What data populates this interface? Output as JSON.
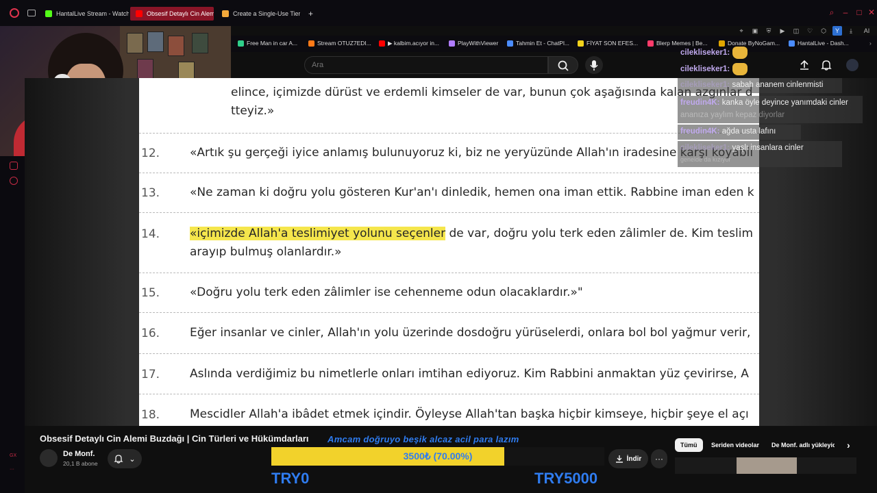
{
  "browser": {
    "tabs": [
      {
        "label": "HantalLive Stream - Watch",
        "color": "#53fc18",
        "active": false
      },
      {
        "label": "Obsesif Detaylı Cin Alemi",
        "color": "#ff0000",
        "active": true
      },
      {
        "label": "Create a Single-Use Tier L",
        "color": "#f4a93b",
        "active": false
      }
    ],
    "new_tab": "+",
    "bookmarks": [
      {
        "label": "Free Man in car A...",
        "color": "#2fcf8a"
      },
      {
        "label": "Stream OTUZ7EDI...",
        "color": "#ff7a18"
      },
      {
        "label": "▶ kalbim.acıyor in...",
        "color": "#ff0000"
      },
      {
        "label": "PlayWithViewer",
        "color": "#b07cff"
      },
      {
        "label": "Tahmin Et - ChatPl...",
        "color": "#4b8cff"
      },
      {
        "label": "FİYAT SON EFES...",
        "color": "#f2d21b"
      },
      {
        "label": "Blerp Memes | Be...",
        "color": "#ff3b6b"
      },
      {
        "label": "Donate ByNoGam...",
        "color": "#e0a500"
      },
      {
        "label": "HantalLive - Dash...",
        "color": "#4b8cff"
      }
    ],
    "extension_ai": "AI",
    "extension_y": "Y"
  },
  "youtube": {
    "search_placeholder": "Ara",
    "video_title": "Obsesif Detaylı Cin Alemi Buzdağı | Cin Türleri ve Hükümdarları",
    "channel_name": "De Monf.",
    "subscribers": "20,1 B abone",
    "download_label": "İndir",
    "more_label": "···",
    "chips": [
      "Tümü",
      "Seriden videolar",
      "De Monf. adlı yükleyic"
    ],
    "chip_next": "›"
  },
  "document": {
    "lines": [
      {
        "num": "",
        "text": "elince, içimizde dürüst ve erdemli kimseler de var, bunun çok aşağısında kalan azgınlar d"
      },
      {
        "num": "",
        "text": "tteyiz.»"
      },
      {
        "num": "12.",
        "text": "«Artık şu gerçeği iyice anlamış bulunuyoruz ki, biz ne yeryüzünde Allah'ın iradesine karşı koyabil"
      },
      {
        "num": "13.",
        "text": "«Ne zaman ki doğru yolu gösteren Kur'an'ı dinledik, hemen ona iman ettik. Rabbine iman eden k"
      },
      {
        "num": "14.",
        "highlight": "«içimizde Allah'a teslimiyet yolunu seçenler",
        "text": " de var, doğru yolu terk eden zâlimler de. Kim teslim"
      },
      {
        "num": "",
        "text": "arayıp bulmuş olanlardır.»"
      },
      {
        "num": "15.",
        "text": "«Doğru yolu terk eden zâlimler ise cehenneme odun olacaklardır.»\""
      },
      {
        "num": "16.",
        "text": "Eğer insanlar ve cinler, Allah'ın yolu üzerinde dosdoğru yürüselerdi, onlara bol bol yağmur verir,"
      },
      {
        "num": "17.",
        "text": "Aslında verdiğimiz bu nimetlerle onları imtihan ediyoruz. Kim Rabbini anmaktan yüz çevirirse, A"
      },
      {
        "num": "18.",
        "text": "Mescidler Allah'a ibâdet etmek içindir. Öyleyse Allah'tan başka hiçbir kimseye, hiçbir şeye el açı"
      }
    ]
  },
  "chat": [
    {
      "user": "cilekliseker1:",
      "msg": "",
      "emote": true
    },
    {
      "user": "cilekliseker1:",
      "msg": "",
      "emote": true
    },
    {
      "user": "cilekliseker1:",
      "msg": "sabah ananem cinlenmisti",
      "emote": false
    },
    {
      "user": "freudin4K:",
      "msg": "kanka öyle deyince yanımdaki cinler",
      "emote": false
    },
    {
      "user": "",
      "msg": "ananıza yaylım kepaz diyorlar",
      "emote": false
    },
    {
      "user": "freudin4K:",
      "msg": "ağda usta lafını",
      "emote": false
    },
    {
      "user": "cilekliseker1:",
      "msg": "yaşlı insanlara cinler",
      "emote": false
    },
    {
      "user": "",
      "msg": "genelde da kızıyor",
      "emote": false
    }
  ],
  "donation": {
    "message": "Amcam doğruyo beşik alcaz acil para lazım",
    "progress_text": "3500₺ (70.00%)",
    "progress_fraction": 0.7,
    "min_label": "TRY0",
    "max_label": "TRY5000",
    "accent": "#2f7cf0",
    "fill": "#f2d22b"
  }
}
